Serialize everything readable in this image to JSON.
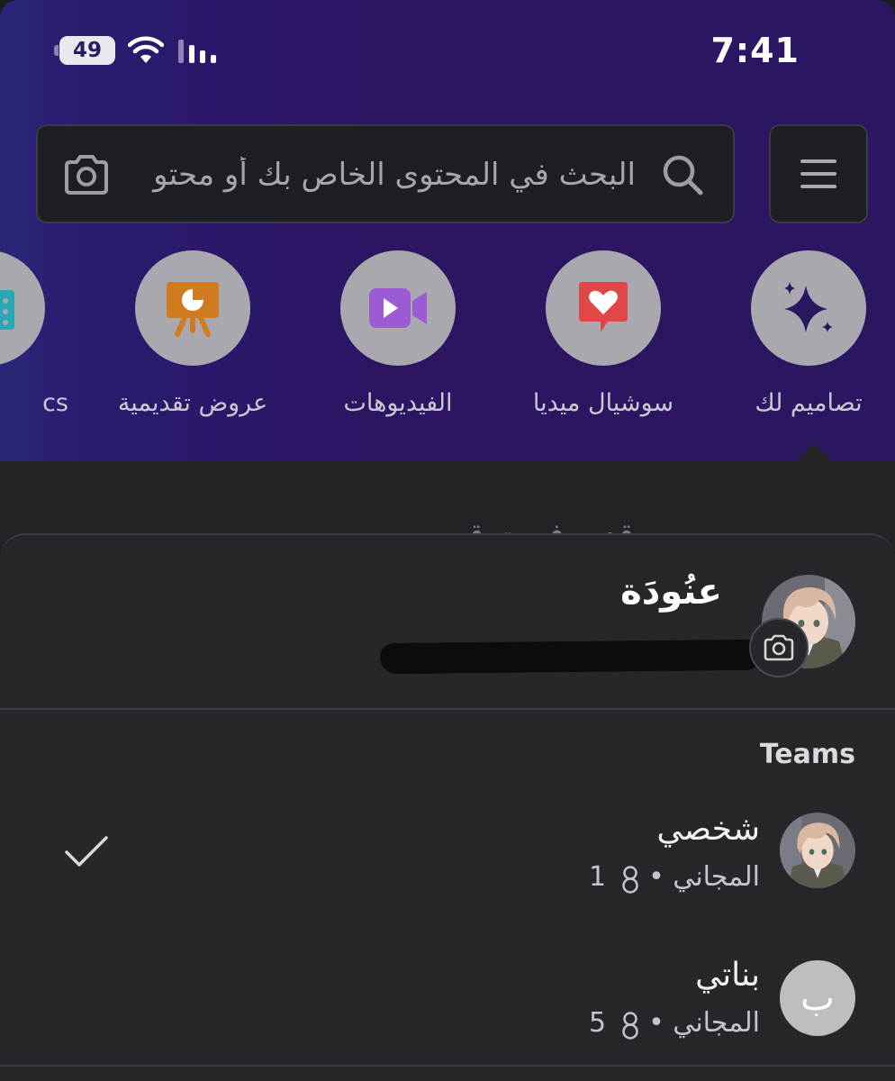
{
  "status_bar": {
    "time": "7:41",
    "battery": "49",
    "icons": [
      "battery-icon",
      "wifi-icon",
      "signal-icon"
    ]
  },
  "search": {
    "placeholder": "البحث في المحتوى الخاص بك أو محتو",
    "icons": [
      "search-icon",
      "camera-icon"
    ]
  },
  "menu": {
    "icon": "hamburger-menu-icon"
  },
  "categories": [
    {
      "label": "تصاميم لك",
      "icon": "sparkle-icon",
      "color": "#2b1661"
    },
    {
      "label": "سوشيال ميديا",
      "icon": "heart-bubble-icon",
      "color": "#e04848"
    },
    {
      "label": "الفيديوهات",
      "icon": "video-camera-icon",
      "color": "#9b5bd2"
    },
    {
      "label": "عروض تقديمية",
      "icon": "presentation-icon",
      "color": "#d07b1e"
    },
    {
      "label": "cs",
      "icon": "partial-category-icon",
      "color": "#2aa7b7"
    }
  ],
  "background_text": "قديم ف ت ق",
  "profile": {
    "name": "عنُودَة",
    "email_redacted": "",
    "camera_icon": "camera-icon"
  },
  "teams": {
    "label": "Teams",
    "items": [
      {
        "name": "شخصي",
        "plan": "المجاني •",
        "members": "1",
        "selected": true,
        "avatar": "anime-avatar"
      },
      {
        "name": "بناتي",
        "plan": "المجاني •",
        "members": "5",
        "selected": false,
        "avatar_letter": "ب"
      }
    ]
  },
  "colors": {
    "hero_gradient": "#2c1663",
    "sheet_bg": "#26272b",
    "circle_bg": "#a9a8ae"
  }
}
